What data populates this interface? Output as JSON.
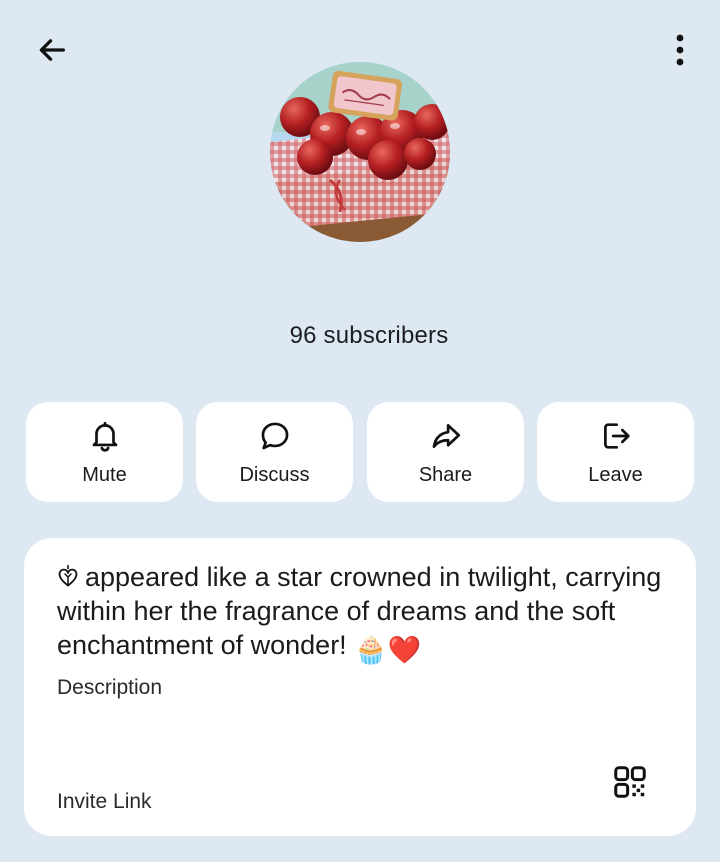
{
  "header": {
    "back_icon": "arrow-left-icon",
    "menu_icon": "more-vert-icon"
  },
  "channel": {
    "subscribers": "96 subscribers"
  },
  "actions": [
    {
      "label": "Mute",
      "icon": "bell-icon"
    },
    {
      "label": "Discuss",
      "icon": "chat-bubble-icon"
    },
    {
      "label": "Share",
      "icon": "share-arrow-icon"
    },
    {
      "label": "Leave",
      "icon": "logout-icon"
    }
  ],
  "info": {
    "description_text": "appeared like a star crowned in twilight, carrying within her the fragrance of dreams and the soft enchantment of wonder!",
    "description_emojis": "🧁❤️",
    "description_label": "Description",
    "invite_label": "Invite Link",
    "qr_icon": "qr-code-icon"
  },
  "colors": {
    "background": "#dde8f3",
    "card": "#ffffff",
    "text": "#1b1b1f"
  }
}
